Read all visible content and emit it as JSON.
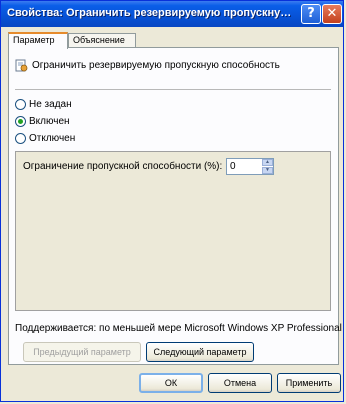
{
  "window": {
    "title": "Свойства: Ограничить резервируемую пропускную спос...",
    "help_glyph": "?",
    "close_glyph": "✕"
  },
  "tabs": [
    {
      "label": "Параметр",
      "active": true
    },
    {
      "label": "Объяснение",
      "active": false
    }
  ],
  "policy": {
    "icon": "policy-setting-icon",
    "name": "Ограничить резервируемую пропускную способность"
  },
  "radios": [
    {
      "label": "Не задан",
      "checked": false
    },
    {
      "label": "Включен",
      "checked": true
    },
    {
      "label": "Отключен",
      "checked": false
    }
  ],
  "option": {
    "label": "Ограничение пропускной способности (%):",
    "value": "0"
  },
  "supported_on": "Поддерживается: по меньшей мере Microsoft Windows XP Professional",
  "nav": {
    "prev": "Предыдущий параметр",
    "next": "Следующий параметр"
  },
  "footer": {
    "ok": "ОК",
    "cancel": "Отмена",
    "apply": "Применить"
  }
}
